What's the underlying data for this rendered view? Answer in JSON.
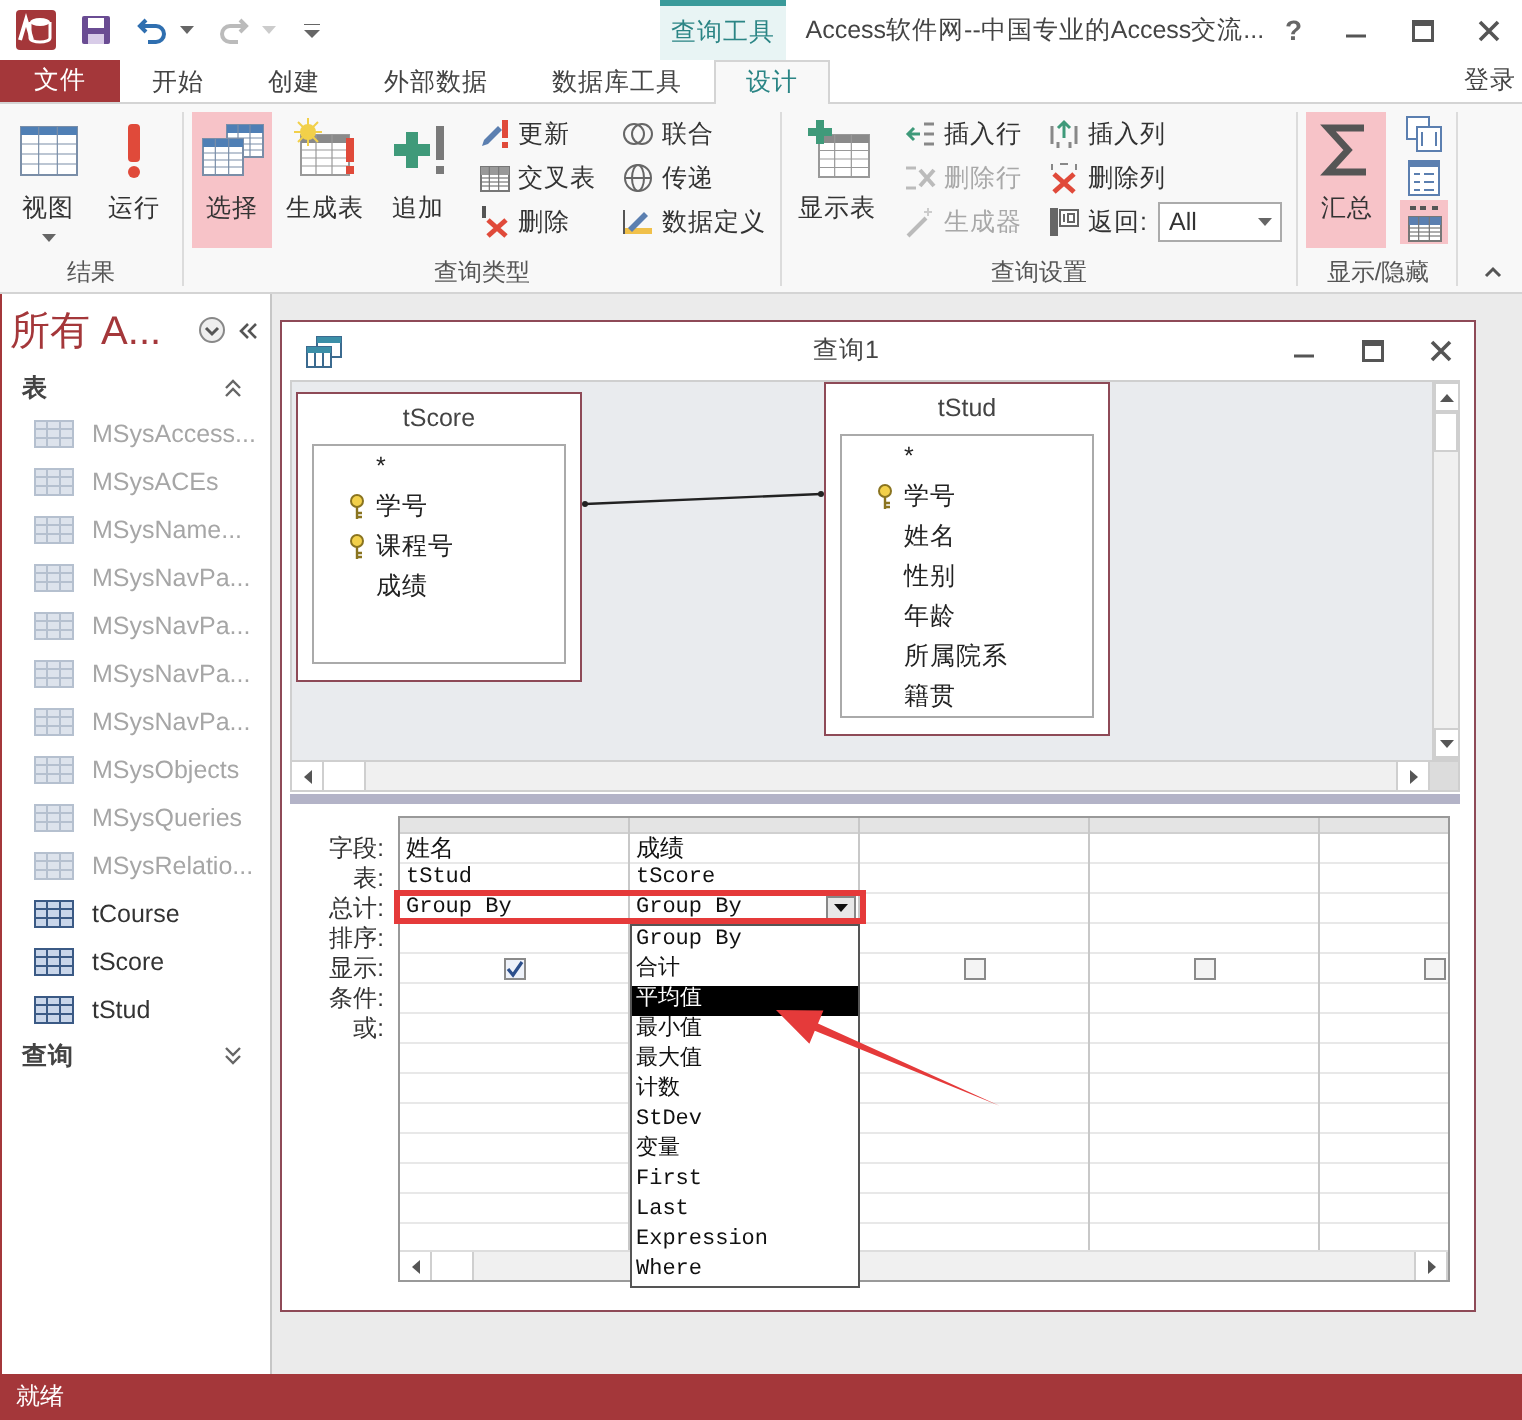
{
  "title_bar": {
    "quick_access": [
      {
        "kind": "save",
        "disabled": false
      },
      {
        "kind": "undo",
        "disabled": false
      },
      {
        "kind": "redo",
        "disabled": true
      }
    ],
    "context_tab": "查询工具",
    "title": "Access软件网--中国专业的Access交流...",
    "help": "?"
  },
  "ribbon_tabs": [
    {
      "label": "文件",
      "kind": "file",
      "selected": false
    },
    {
      "label": "开始",
      "kind": "tab",
      "selected": false
    },
    {
      "label": "创建",
      "kind": "tab",
      "selected": false
    },
    {
      "label": "外部数据",
      "kind": "tab",
      "selected": false
    },
    {
      "label": "数据库工具",
      "kind": "tab",
      "selected": false
    },
    {
      "label": "设计",
      "kind": "tab",
      "selected": true
    }
  ],
  "account": "登录",
  "ribbon_groups": [
    {
      "label": "结果",
      "commands": [
        {
          "kind": "large",
          "label": "视图",
          "dropdown": true,
          "selected": false,
          "disabled": false
        },
        {
          "kind": "large",
          "label": "运行",
          "dropdown": false,
          "selected": false,
          "disabled": false
        }
      ]
    },
    {
      "label": "查询类型",
      "commands": [
        {
          "kind": "large",
          "label": "选择",
          "dropdown": false,
          "selected": true,
          "disabled": false
        },
        {
          "kind": "large",
          "label": "生成表",
          "dropdown": false,
          "selected": false,
          "disabled": false
        },
        {
          "kind": "large",
          "label": "追加",
          "dropdown": false,
          "selected": false,
          "disabled": false
        },
        {
          "kind": "small",
          "label": "更新",
          "selected": false,
          "disabled": false
        },
        {
          "kind": "small",
          "label": "交叉表",
          "selected": false,
          "disabled": false
        },
        {
          "kind": "small",
          "label": "删除",
          "selected": false,
          "disabled": false
        },
        {
          "kind": "small",
          "label": "联合",
          "selected": false,
          "disabled": false
        },
        {
          "kind": "small",
          "label": "传递",
          "selected": false,
          "disabled": false
        },
        {
          "kind": "small",
          "label": "数据定义",
          "selected": false,
          "disabled": false
        }
      ]
    },
    {
      "label": "查询设置",
      "commands": [
        {
          "kind": "large",
          "label": "显示表",
          "dropdown": false,
          "selected": false,
          "disabled": false
        },
        {
          "kind": "small",
          "label": "插入行",
          "selected": false,
          "disabled": false
        },
        {
          "kind": "small",
          "label": "删除行",
          "selected": false,
          "disabled": true
        },
        {
          "kind": "small",
          "label": "生成器",
          "selected": false,
          "disabled": true
        },
        {
          "kind": "small",
          "label": "插入列",
          "selected": false,
          "disabled": false
        },
        {
          "kind": "small",
          "label": "删除列",
          "selected": false,
          "disabled": false
        },
        {
          "kind": "combo",
          "label": "返回:",
          "value": "All"
        }
      ]
    },
    {
      "label": "显示/隐藏",
      "commands": [
        {
          "kind": "large",
          "label": "汇总",
          "dropdown": false,
          "selected": true,
          "disabled": false
        },
        {
          "kind": "icon",
          "selected": false,
          "disabled": false
        },
        {
          "kind": "icon",
          "selected": false,
          "disabled": false
        },
        {
          "kind": "icon",
          "selected": true,
          "disabled": false
        }
      ]
    }
  ],
  "navigation": {
    "title": "所有 A...",
    "sections": [
      {
        "label": "表",
        "expanded": true,
        "items": [
          {
            "label": "MSysAccess...",
            "system": true
          },
          {
            "label": "MSysACEs",
            "system": true
          },
          {
            "label": "MSysName...",
            "system": true
          },
          {
            "label": "MSysNavPa...",
            "system": true
          },
          {
            "label": "MSysNavPa...",
            "system": true
          },
          {
            "label": "MSysNavPa...",
            "system": true
          },
          {
            "label": "MSysNavPa...",
            "system": true
          },
          {
            "label": "MSysObjects",
            "system": true
          },
          {
            "label": "MSysQueries",
            "system": true
          },
          {
            "label": "MSysRelatio...",
            "system": true
          },
          {
            "label": "tCourse",
            "system": false
          },
          {
            "label": "tScore",
            "system": false
          },
          {
            "label": "tStud",
            "system": false
          }
        ]
      },
      {
        "label": "查询",
        "expanded": false
      }
    ]
  },
  "query": {
    "title": "查询1",
    "tables": [
      {
        "name": "tScore",
        "fields": [
          {
            "name": "*",
            "key": false
          },
          {
            "name": "学号",
            "key": true
          },
          {
            "name": "课程号",
            "key": true
          },
          {
            "name": "成绩",
            "key": false
          }
        ]
      },
      {
        "name": "tStud",
        "fields": [
          {
            "name": "*",
            "key": false
          },
          {
            "name": "学号",
            "key": true
          },
          {
            "name": "姓名",
            "key": false
          },
          {
            "name": "性别",
            "key": false
          },
          {
            "name": "年龄",
            "key": false
          },
          {
            "name": "所属院系",
            "key": false
          },
          {
            "name": "籍贯",
            "key": false
          }
        ]
      }
    ],
    "grid": {
      "row_labels": [
        "字段:",
        "表:",
        "总计:",
        "排序:",
        "显示:",
        "条件:",
        "或:"
      ],
      "columns": [
        {
          "field": "姓名",
          "table": "tStud",
          "total": "Group By",
          "show": true
        },
        {
          "field": "成绩",
          "table": "tScore",
          "total": "Group By",
          "active": true,
          "options": [
            {
              "label": "Group By",
              "selected": false
            },
            {
              "label": "合计",
              "selected": false
            },
            {
              "label": "平均值",
              "selected": true
            },
            {
              "label": "最小值",
              "selected": false
            },
            {
              "label": "最大值",
              "selected": false
            },
            {
              "label": "计数",
              "selected": false
            },
            {
              "label": "StDev",
              "selected": false
            },
            {
              "label": "变量",
              "selected": false
            },
            {
              "label": "First",
              "selected": false
            },
            {
              "label": "Last",
              "selected": false
            },
            {
              "label": "Expression",
              "selected": false
            },
            {
              "label": "Where",
              "selected": false
            }
          ]
        },
        {
          "show": false
        },
        {
          "show": false
        },
        {
          "show": false
        }
      ]
    }
  },
  "status": "就绪"
}
